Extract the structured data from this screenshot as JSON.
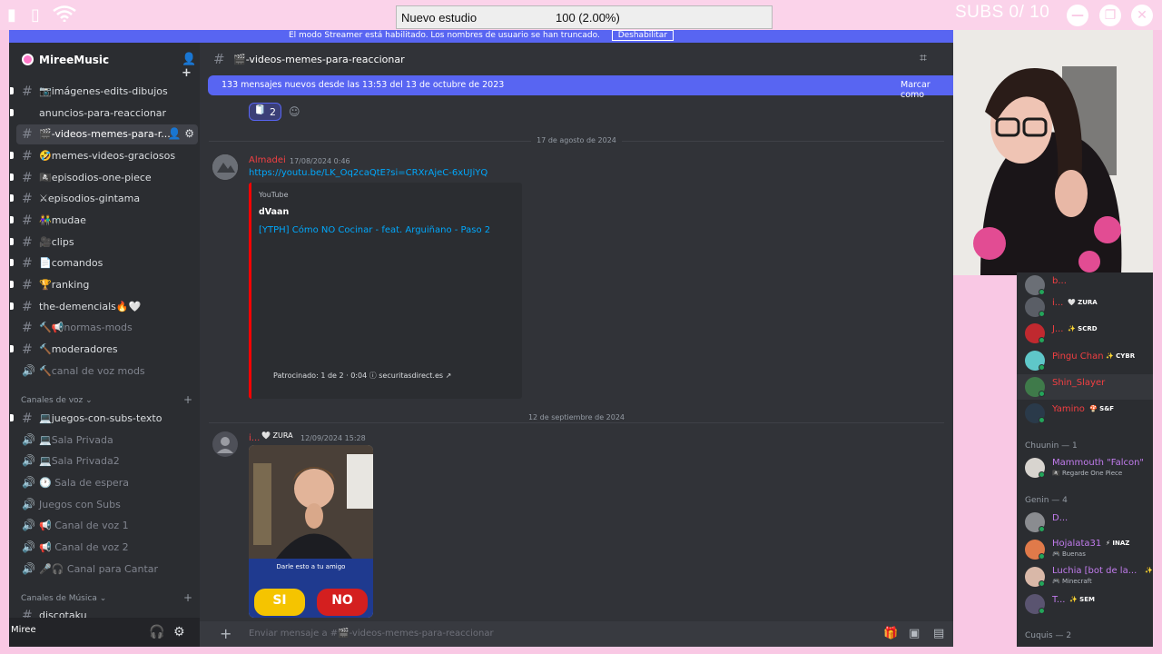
{
  "overlay": {
    "goal_title": "Nuevo estudio",
    "goal_progress": "100 (2.00%)",
    "subs_counter": "SUBS 0/ 10"
  },
  "streamer_banner": {
    "text": "El modo Streamer está habilitado. Los nombres de usuario se han truncado.",
    "button": "Deshabilitar"
  },
  "sidebar": {
    "server_name": "MireeMusic",
    "text_channels": [
      {
        "label": "📷imágenes-edits-dibujos",
        "muted": false
      },
      {
        "label": "anuncios-para-reaccionar",
        "muted": false
      },
      {
        "label": "🎬-videos-memes-para-r...",
        "muted": false,
        "selected": true
      },
      {
        "label": "🤣memes-videos-graciosos",
        "muted": false
      },
      {
        "label": "🏴‍☠️episodios-one-piece",
        "muted": false
      },
      {
        "label": "⚔episodios-gintama",
        "muted": false
      },
      {
        "label": "👫mudae",
        "muted": false
      },
      {
        "label": "🎥clips",
        "muted": false
      },
      {
        "label": "📄comandos",
        "muted": false
      },
      {
        "label": "🏆ranking",
        "muted": false
      },
      {
        "label": "the-demencials🔥🤍",
        "muted": false
      },
      {
        "label": "🔨📢normas-mods",
        "muted": true
      },
      {
        "label": "🔨moderadores",
        "muted": false
      }
    ],
    "mods_voice": "🔨canal de voz mods",
    "voice_category": "Canales de voz",
    "voice_channels": [
      {
        "label": "💻juegos-con-subs-texto",
        "type": "text"
      },
      {
        "label": "💻Sala Privada",
        "type": "voice"
      },
      {
        "label": "💻Sala Privada2",
        "type": "voice"
      },
      {
        "label": "🕐 Sala de espera",
        "type": "voice"
      },
      {
        "label": "Juegos con Subs",
        "type": "voice"
      },
      {
        "label": "📢 Canal de voz 1",
        "type": "voice"
      },
      {
        "label": "📢 Canal de voz 2",
        "type": "voice"
      },
      {
        "label": "🎤🎧 Canal para Cantar",
        "type": "voice"
      }
    ],
    "music_category": "Canales de Música",
    "music_channel": "discotaku",
    "user_name": "Miree"
  },
  "main": {
    "channel_title": "🎬-videos-memes-para-reaccionar",
    "new_messages": "133 mensajes nuevos desde las 13:53 del 13 de octubre de 2023",
    "mark_read": "Marcar como",
    "reaction_count": "2",
    "date1": "17 de agosto de 2024",
    "msg1": {
      "author": "Almadei",
      "time": "17/08/2024 0:46",
      "link": "https://youtu.be/LK_Oq2caQtE?si=CRXrAjeC-6xUJiYQ",
      "embed_provider": "YouTube",
      "embed_author": "dVaan",
      "embed_title": "[YTPH] Cómo NO Cocinar - feat. Arguiñano - Paso 2",
      "video_info": "Patrocinado: 1 de 2 · 0:04 ⓘ securitasdirect.es ↗"
    },
    "date2": "12 de septiembre de 2024",
    "msg2": {
      "author": "i...",
      "badge": "🤍 ZURA",
      "time": "12/09/2024 15:28",
      "image_caption": "Darle esto a tu amigo",
      "image_yes": "SI",
      "image_no": "NO"
    },
    "input_placeholder": "Enviar mensaje a #🎬-videos-memes-para-reaccionar"
  },
  "members": {
    "top": [
      {
        "name": "b...",
        "tag": "",
        "color": "#f23f42"
      },
      {
        "name": "i...",
        "tag": "🤍 ZURA",
        "color": "#f23f42"
      },
      {
        "name": "J...",
        "tag": "✨ SCRD",
        "color": "#f23f42"
      },
      {
        "name": "Pingu Chan",
        "tag": "✨ CYBR",
        "color": "#f23f42"
      },
      {
        "name": "Shin_Slayer",
        "tag": "",
        "color": "#f23f42"
      },
      {
        "name": "Yamino",
        "tag": "🍄 S&F",
        "color": "#f23f42"
      }
    ],
    "chuunin_header": "Chuunin — 1",
    "chuunin": [
      {
        "name": "Mammouth \"Falcon\"",
        "status": "🏴‍☠️ Regarde One Piece",
        "color": "#c27cee"
      }
    ],
    "genin_header": "Genin — 4",
    "genin": [
      {
        "name": "D...",
        "tag": "",
        "status": "",
        "color": "#c27cee"
      },
      {
        "name": "Hojalata31",
        "tag": "⚡ INAZ",
        "status": "🎮 Buenas",
        "color": "#c27cee"
      },
      {
        "name": "Luchia [bot de la...",
        "tag": "✨ F",
        "status": "🎮 Minecraft",
        "color": "#c27cee"
      },
      {
        "name": "T...",
        "tag": "✨ SEM",
        "status": "",
        "color": "#c27cee"
      }
    ],
    "cuquis_header": "Cuquis — 2"
  }
}
